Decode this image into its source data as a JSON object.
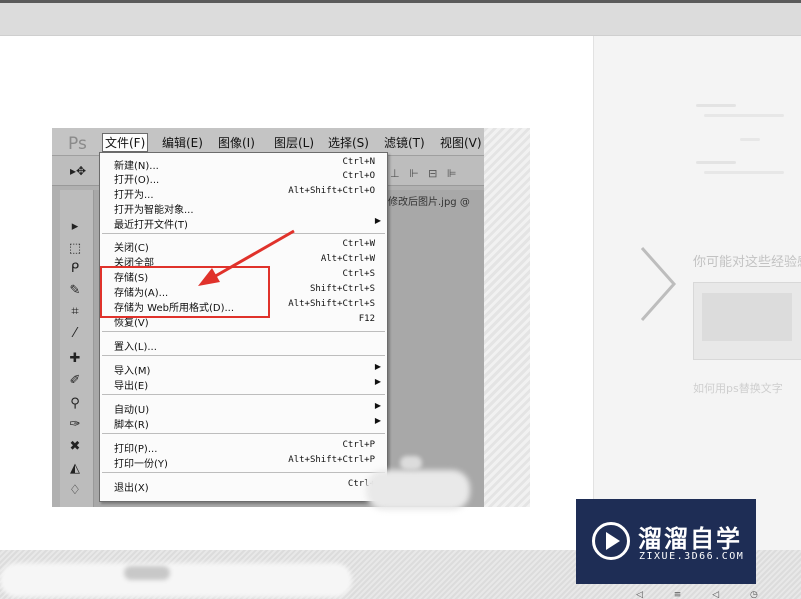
{
  "photoshop": {
    "logo": "Ps",
    "menubar": [
      {
        "label": "文件(F)",
        "active": true
      },
      {
        "label": "编辑(E)"
      },
      {
        "label": "图像(I)"
      },
      {
        "label": "图层(L)"
      },
      {
        "label": "选择(S)"
      },
      {
        "label": "滤镜(T)"
      },
      {
        "label": "视图(V)"
      }
    ],
    "doc_tab": "修改后图片.jpg @",
    "file_menu": [
      {
        "label": "新建(N)...",
        "shortcut": "Ctrl+N"
      },
      {
        "label": "打开(O)...",
        "shortcut": "Ctrl+O"
      },
      {
        "label": "打开为...",
        "shortcut": "Alt+Shift+Ctrl+O"
      },
      {
        "label": "打开为智能对象...",
        "shortcut": ""
      },
      {
        "label": "最近打开文件(T)",
        "shortcut": "",
        "submenu": true
      },
      {
        "label": "关闭(C)",
        "shortcut": "Ctrl+W"
      },
      {
        "label": "关闭全部",
        "shortcut": "Alt+Ctrl+W"
      },
      {
        "label": "存储(S)",
        "shortcut": "Ctrl+S"
      },
      {
        "label": "存储为(A)...",
        "shortcut": "Shift+Ctrl+S"
      },
      {
        "label": "存储为 Web所用格式(D)...",
        "shortcut": "Alt+Shift+Ctrl+S"
      },
      {
        "label": "恢复(V)",
        "shortcut": "F12"
      },
      {
        "label": "置入(L)...",
        "shortcut": ""
      },
      {
        "label": "导入(M)",
        "shortcut": "",
        "submenu": true
      },
      {
        "label": "导出(E)",
        "shortcut": "",
        "submenu": true
      },
      {
        "label": "自动(U)",
        "shortcut": "",
        "submenu": true
      },
      {
        "label": "脚本(R)",
        "shortcut": "",
        "submenu": true
      },
      {
        "label": "打印(P)...",
        "shortcut": "Ctrl+P"
      },
      {
        "label": "打印一份(Y)",
        "shortcut": "Alt+Shift+Ctrl+P"
      },
      {
        "label": "退出(X)",
        "shortcut": "Ctrl+"
      }
    ],
    "submenu_glyph": "▶"
  },
  "right_panel": {
    "section_title": "你可能对这些经验感兴趣",
    "card_caption": "如何用ps替换文字"
  },
  "watermark": {
    "name": "溜溜自学",
    "url": "ZIXUE.3D66.COM"
  },
  "colors": {
    "highlight": "#e0322b",
    "watermark_bg": "#1e2d55"
  }
}
